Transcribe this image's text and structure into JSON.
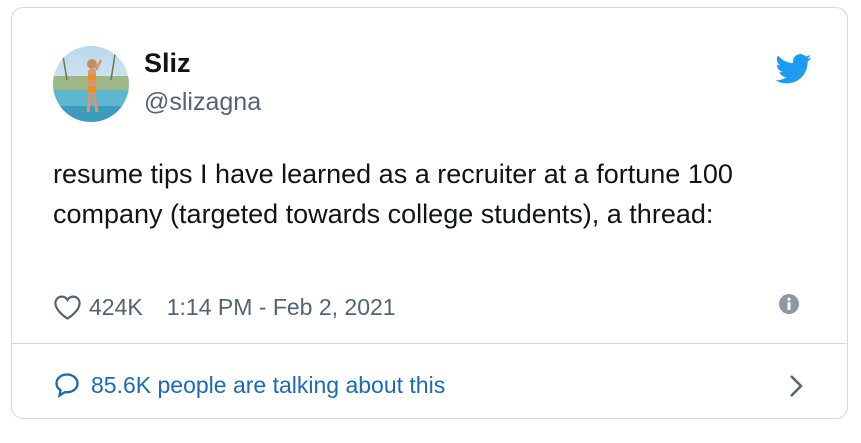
{
  "tweet": {
    "display_name": "Sliz",
    "handle": "@slizagna",
    "text": "resume tips I have learned as a recruiter at a fortune 100 company (targeted towards college students), a thread:",
    "likes": "424K",
    "timestamp": "1:14 PM - Feb 2, 2021",
    "talking": "85.6K people are talking about this"
  },
  "icons": {
    "brand": "twitter-bird-icon",
    "like": "heart-icon",
    "info": "info-icon",
    "conversation": "speech-bubble-icon",
    "more": "chevron-right-icon"
  },
  "colors": {
    "brand_blue": "#1d9bf0",
    "link_blue": "#1b6ab3",
    "text": "#0f1419",
    "muted": "#536471",
    "border": "#cfd9de"
  }
}
